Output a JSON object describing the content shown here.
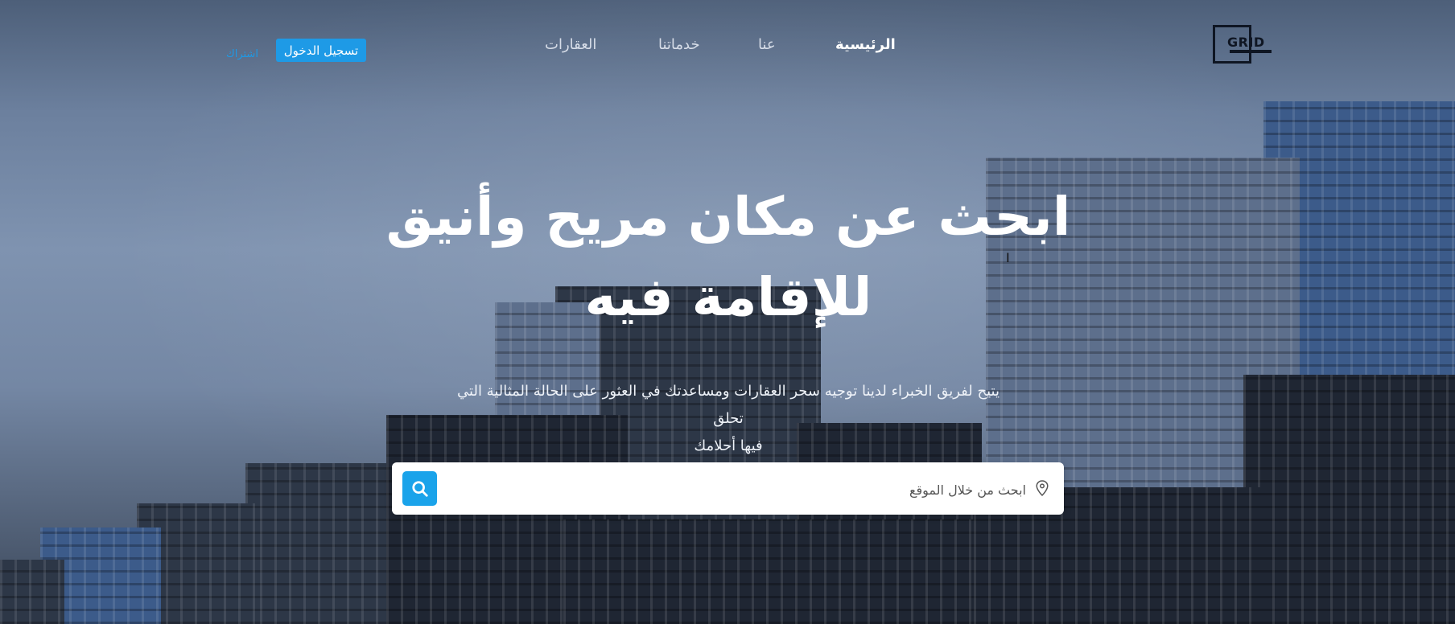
{
  "header": {
    "logo_text": "GRID",
    "nav": [
      {
        "label": "الرئيسية",
        "active": true
      },
      {
        "label": "عنا",
        "active": false
      },
      {
        "label": "خدماتنا",
        "active": false
      },
      {
        "label": "العقارات",
        "active": false
      }
    ],
    "login_label": "تسجيل الدخول",
    "register_label": "اشتراك"
  },
  "hero": {
    "headline_line1": "ابحث عن مكان مريح وأنيق",
    "headline_line2": "للإقامة فيه",
    "subtext_line1": "يتيح لفريق الخبراء لدينا توجيه سحر العقارات ومساعدتك في العثور على الحالة المثالية التي تحلق",
    "subtext_line2": "فيها أحلامك"
  },
  "search": {
    "placeholder": "ابحث من خلال الموقع",
    "location_icon": "location-pin-icon",
    "button_icon": "search-icon"
  },
  "colors": {
    "accent": "#1e9ae6",
    "search_button": "#1aa3ea"
  }
}
